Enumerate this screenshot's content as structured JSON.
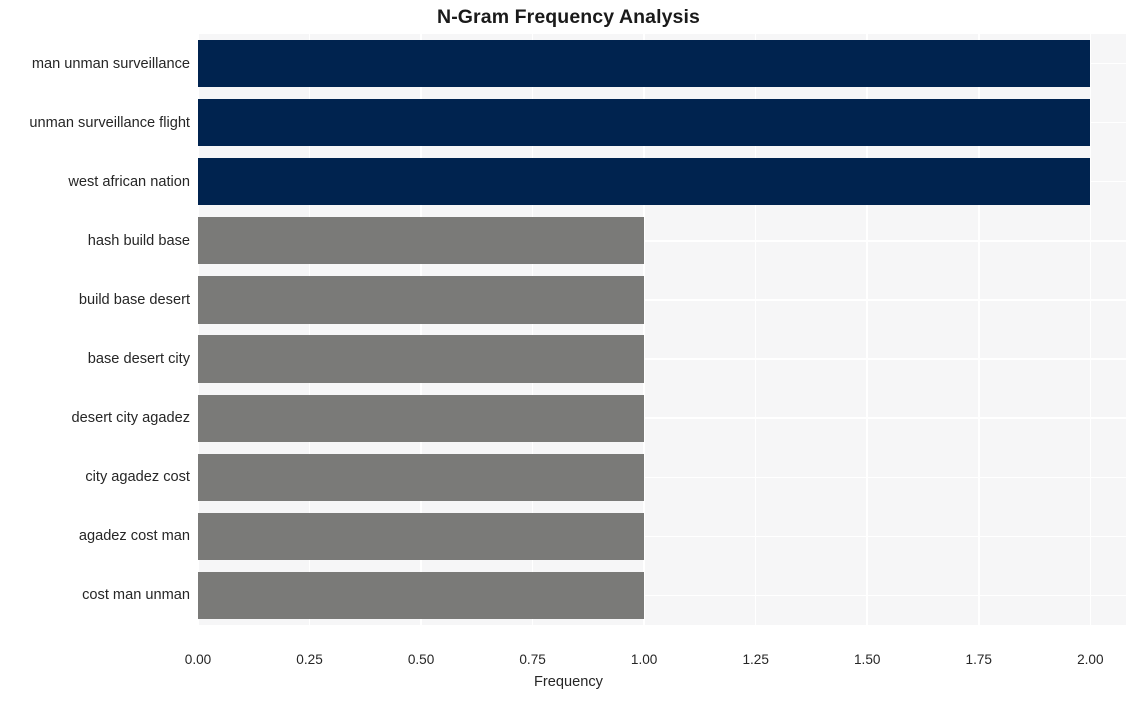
{
  "chart_data": {
    "type": "bar",
    "orientation": "horizontal",
    "title": "N-Gram Frequency Analysis",
    "xlabel": "Frequency",
    "ylabel": "",
    "categories": [
      "man unman surveillance",
      "unman surveillance flight",
      "west african nation",
      "hash build base",
      "build base desert",
      "base desert city",
      "desert city agadez",
      "city agadez cost",
      "agadez cost man",
      "cost man unman"
    ],
    "values": [
      2,
      2,
      2,
      1,
      1,
      1,
      1,
      1,
      1,
      1
    ],
    "bar_colors": [
      "#00234f",
      "#00234f",
      "#00234f",
      "#7a7a78",
      "#7a7a78",
      "#7a7a78",
      "#7a7a78",
      "#7a7a78",
      "#7a7a78",
      "#7a7a78"
    ],
    "xlim": [
      0,
      2.08
    ],
    "xticks": [
      0,
      0.25,
      0.5,
      0.75,
      1,
      1.25,
      1.5,
      1.75,
      2
    ],
    "xtick_labels": [
      "0.00",
      "0.25",
      "0.50",
      "0.75",
      "1.00",
      "1.25",
      "1.50",
      "1.75",
      "2.00"
    ],
    "grid": true,
    "grid_color": "#ffffff",
    "plot_background": "#f6f6f7",
    "figure_background": "#ffffff",
    "legend": null,
    "accent_color": "#00234f",
    "secondary_color": "#7a7a78"
  }
}
